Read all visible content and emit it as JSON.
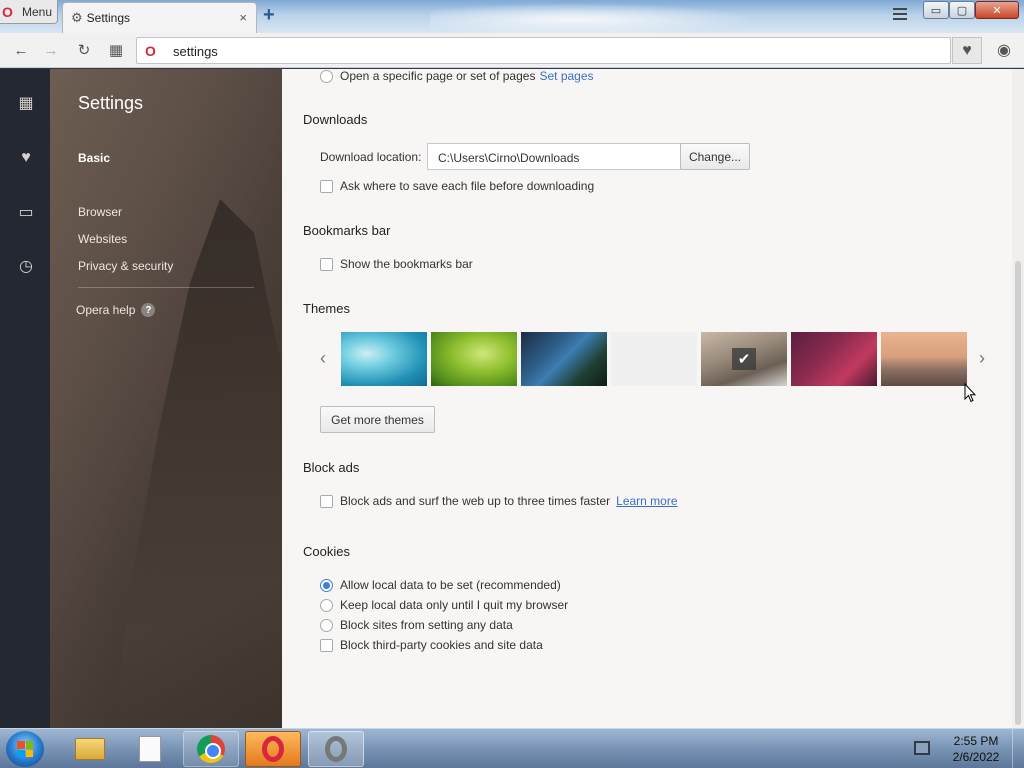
{
  "window": {
    "menu_label": "Menu",
    "tab_title": "Settings",
    "close_tab_glyph": "×",
    "new_tab_glyph": "+",
    "min_glyph": "▭",
    "max_glyph": "▢",
    "close_glyph": "✕"
  },
  "toolbar": {
    "address": "settings",
    "back_glyph": "←",
    "forward_glyph": "→",
    "reload_glyph": "↻",
    "speeddial_glyph": "▦",
    "heart_glyph": "♥",
    "account_glyph": "◉"
  },
  "rail": {
    "speeddial_glyph": "▦",
    "bookmarks_glyph": "♥",
    "tabs_glyph": "▭",
    "history_glyph": "◷"
  },
  "sidebar": {
    "title": "Settings",
    "basic": "Basic",
    "browser": "Browser",
    "websites": "Websites",
    "privacy": "Privacy & security",
    "help": "Opera help",
    "help_icon": "?"
  },
  "startup": {
    "open_specific": "Open a specific page or set of pages",
    "set_pages_link": "Set pages"
  },
  "downloads": {
    "heading": "Downloads",
    "location_label": "Download location:",
    "location_value": "C:\\Users\\Cirno\\Downloads",
    "change_button": "Change...",
    "ask_where": "Ask where to save each file before downloading"
  },
  "bookmarks_bar": {
    "heading": "Bookmarks bar",
    "show": "Show the bookmarks bar"
  },
  "themes": {
    "heading": "Themes",
    "prev_glyph": "‹",
    "next_glyph": "›",
    "check_glyph": "✔",
    "get_more": "Get more themes",
    "selected_index": 5
  },
  "block_ads": {
    "heading": "Block ads",
    "label": "Block ads and surf the web up to three times faster",
    "learn_more": "Learn more"
  },
  "cookies": {
    "heading": "Cookies",
    "options": [
      "Allow local data to be set (recommended)",
      "Keep local data only until I quit my browser",
      "Block sites from setting any data"
    ],
    "selected": 0,
    "third_party": "Block third-party cookies and site data"
  },
  "taskbar": {
    "time": "2:55 PM",
    "date": "2/6/2022"
  },
  "colors": {
    "link": "#3b6fc4",
    "opera_red": "#d7263d",
    "radio_selected": "#3b7fd8"
  },
  "icons": [
    "search-icon",
    "gear-icon",
    "heart-icon",
    "clock-icon",
    "speed-dial-icon"
  ]
}
